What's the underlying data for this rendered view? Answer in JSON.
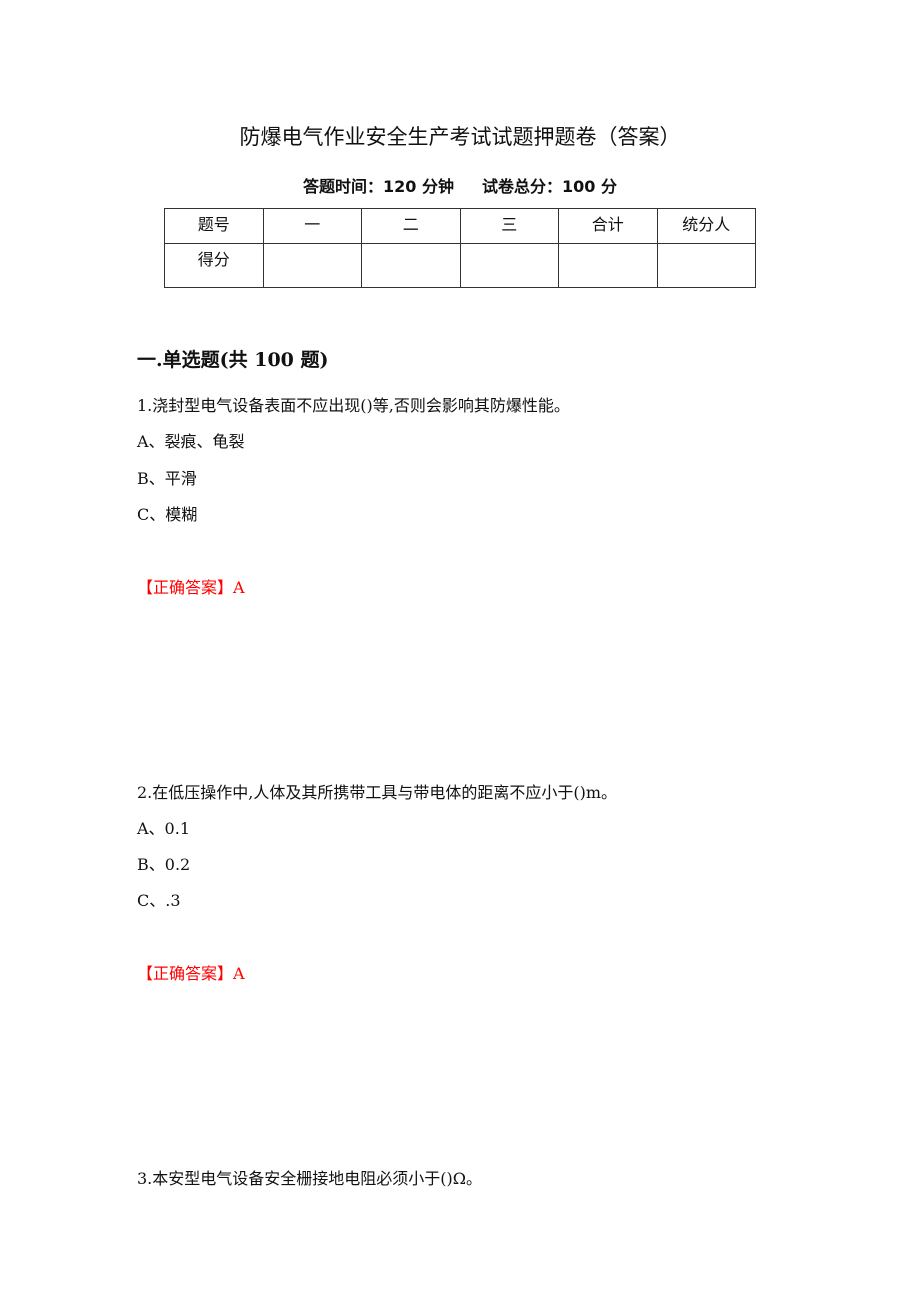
{
  "header": {
    "title": "防爆电气作业安全生产考试试题押题卷（答案）",
    "time_label": "答题时间：120 分钟",
    "total_label": "试卷总分：100 分"
  },
  "score_table": {
    "header_row": [
      "题号",
      "一",
      "二",
      "三",
      "合计",
      "统分人"
    ],
    "score_row": [
      "得分",
      "",
      "",
      "",
      "",
      ""
    ]
  },
  "section": {
    "title": "一.单选题(共 100 题)"
  },
  "questions": [
    {
      "stem": "1.浇封型电气设备表面不应出现()等,否则会影响其防爆性能。",
      "options": [
        "A、裂痕、龟裂",
        "B、平滑",
        "C、模糊"
      ],
      "answer": "【正确答案】A"
    },
    {
      "stem": "2.在低压操作中,人体及其所携带工具与带电体的距离不应小于()m。",
      "options": [
        "A、0.1",
        "B、0.2",
        "C、.3"
      ],
      "answer": "【正确答案】A"
    },
    {
      "stem": "3.本安型电气设备安全栅接地电阻必须小于()Ω。"
    }
  ],
  "colors": {
    "answer": "#ff0000",
    "text": "#111111"
  }
}
